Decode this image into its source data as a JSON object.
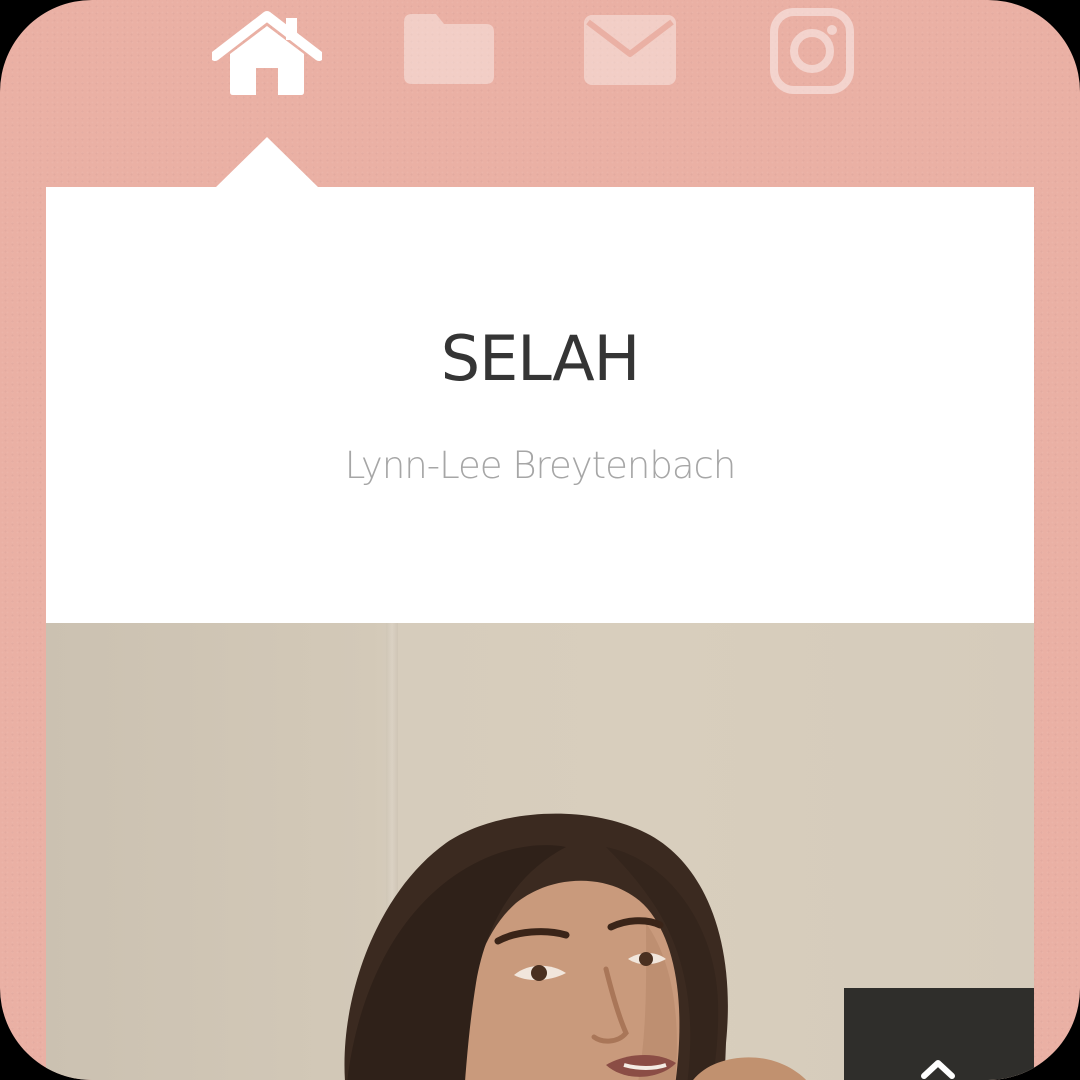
{
  "nav": {
    "items": [
      {
        "icon": "home-icon",
        "active": true
      },
      {
        "icon": "folder-icon",
        "active": false
      },
      {
        "icon": "mail-icon",
        "active": false
      },
      {
        "icon": "instagram-icon",
        "active": false
      }
    ]
  },
  "header": {
    "title": "SELAH",
    "author": "Lynn-Lee Breytenbach"
  },
  "colors": {
    "background": "#eab0a4",
    "card": "#ffffff",
    "title": "#353535",
    "subtitle": "#a6a6a6",
    "to_top_button": "#2f2e2b"
  },
  "photo": {
    "alt": ""
  },
  "to_top": {
    "icon": "chevron-up-icon"
  }
}
